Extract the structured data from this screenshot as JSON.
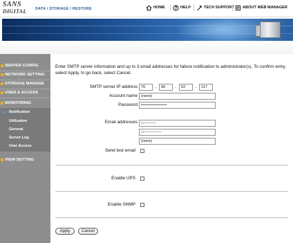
{
  "header": {
    "logo_line1": "SANS",
    "logo_line2": "DIGITAL",
    "breadcrumb": "DATA / STORAGE / RESTORE",
    "nav": {
      "home": "HOME",
      "help": "HELP",
      "tech_support": "TECH SUPPORT",
      "about": "ABOUT WEB MANAGER"
    }
  },
  "sidebar": {
    "items": [
      {
        "label": "SERVER CONFIG"
      },
      {
        "label": "NETWORK SETTING"
      },
      {
        "label": "STORAGE MANAGE"
      },
      {
        "label": "USER & ACCESS"
      },
      {
        "label": "MONITORING"
      }
    ],
    "subitems": [
      {
        "label": "Notification",
        "active": true
      },
      {
        "label": "Utilization"
      },
      {
        "label": "General"
      },
      {
        "label": "Server Log"
      },
      {
        "label": "User Access"
      }
    ],
    "view_setting": "VIEW SETTING"
  },
  "main": {
    "intro": "Enter SMTP server information and up to 3 email addresses for failure notification to administrator(s). To confirm entry, select Apply, to go back, select Cancel.",
    "smtp_label": "SMTP server IP address",
    "ip": [
      "76",
      "96",
      "62",
      "117"
    ],
    "account_label": "Account name",
    "account_value": "(none)",
    "password_label": "Password",
    "password_value": "••••••••••••••••",
    "email_label": "Email addresses",
    "emails": [
      "ja•••••••••",
      "ja•••••••••••••",
      "(none)"
    ],
    "test_email_label": "Send test email",
    "ups_label": "Enable UPS",
    "snmp_label": "Enable SNMP",
    "apply": "Apply",
    "cancel": "Cancel"
  }
}
